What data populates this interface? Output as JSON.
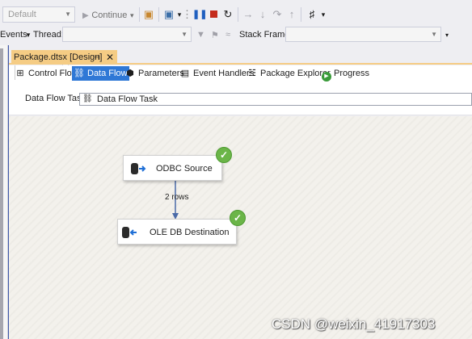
{
  "toolbar": {
    "config_combo": "Default",
    "continue_label": "Continue",
    "continue_caret": "▾"
  },
  "debug_bar": {
    "events_label": "Events",
    "thread_label": "Thread:",
    "thread_value": "",
    "stack_frame_label": "Stack Frame:",
    "stack_frame_value": ""
  },
  "document_tab": {
    "title": "Package.dtsx [Design]",
    "pin": "⊣",
    "close": "✕"
  },
  "designer_tabs": [
    {
      "label": "Control Flow",
      "icon": "control-flow-icon",
      "active": false
    },
    {
      "label": "Data Flow",
      "icon": "data-flow-icon",
      "active": true
    },
    {
      "label": "Parameters",
      "icon": "parameters-icon",
      "active": false
    },
    {
      "label": "Event Handlers",
      "icon": "event-handlers-icon",
      "active": false
    },
    {
      "label": "Package Explorer",
      "icon": "package-explorer-icon",
      "active": false
    },
    {
      "label": "Progress",
      "icon": "progress-icon",
      "active": false
    }
  ],
  "data_flow_task": {
    "label": "Data Flow Task:",
    "selected": "Data Flow Task"
  },
  "components": {
    "source": {
      "label": "ODBC Source",
      "status": "success"
    },
    "destination": {
      "label": "OLE DB Destination",
      "status": "success"
    },
    "path_label": "2 rows"
  },
  "watermark": "CSDN @weixin_41917303",
  "colors": {
    "accent": "#2f78d6",
    "tab_highlight": "#f5cc84",
    "success": "#6bb548"
  }
}
